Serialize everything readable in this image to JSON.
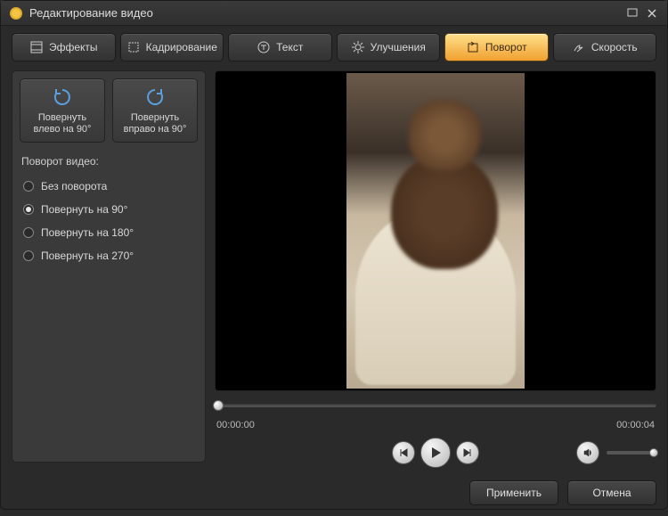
{
  "window": {
    "title": "Редактирование видео"
  },
  "tabs": {
    "effects": "Эффекты",
    "crop": "Кадрирование",
    "text": "Текст",
    "enhance": "Улучшения",
    "rotate": "Поворот",
    "speed": "Скорость"
  },
  "rotate_panel": {
    "left_btn": "Повернуть влево  на 90°",
    "right_btn": "Повернуть вправо на 90°",
    "section_label": "Поворот видео:",
    "options": {
      "none": "Без поворота",
      "r90": "Повернуть на 90°",
      "r180": "Повернуть на 180°",
      "r270": "Повернуть на 270°"
    },
    "selected": "r90"
  },
  "player": {
    "time_start": "00:00:00",
    "time_end": "00:00:04"
  },
  "footer": {
    "apply": "Применить",
    "cancel": "Отмена"
  }
}
